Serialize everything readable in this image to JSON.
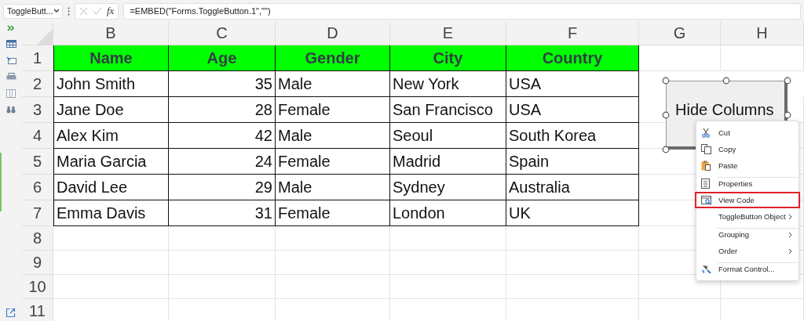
{
  "formula_bar": {
    "name_box": "ToggleButt...",
    "function_label": "fx",
    "formula": "=EMBED(\"Forms.ToggleButton.1\",\"\")"
  },
  "column_headers": [
    "B",
    "C",
    "D",
    "E",
    "F",
    "G",
    "H"
  ],
  "row_headers": [
    "1",
    "2",
    "3",
    "4",
    "5",
    "6",
    "7",
    "8",
    "9",
    "10",
    "11"
  ],
  "table": {
    "columns": [
      "Name",
      "Age",
      "Gender",
      "City",
      "Country"
    ],
    "rows": [
      [
        "John Smith",
        "35",
        "Male",
        "New York",
        "USA"
      ],
      [
        "Jane Doe",
        "28",
        "Female",
        "San Francisco",
        "USA"
      ],
      [
        "Alex Kim",
        "42",
        "Male",
        "Seoul",
        "South Korea"
      ],
      [
        "Maria Garcia",
        "24",
        "Female",
        "Madrid",
        "Spain"
      ],
      [
        "David Lee",
        "29",
        "Male",
        "Sydney",
        "Australia"
      ],
      [
        "Emma Davis",
        "31",
        "Female",
        "London",
        "UK"
      ]
    ]
  },
  "toggle_button": {
    "label": "Hide Columns",
    "selected": true
  },
  "context_menu": [
    {
      "label": "Cut",
      "separator_before": false,
      "highlighted": false,
      "submenu": false
    },
    {
      "label": "Copy",
      "separator_before": false,
      "highlighted": false,
      "submenu": false
    },
    {
      "label": "Paste",
      "separator_before": false,
      "highlighted": false,
      "submenu": false
    },
    {
      "label": "Properties",
      "separator_before": true,
      "highlighted": false,
      "submenu": false
    },
    {
      "label": "View Code",
      "separator_before": false,
      "highlighted": true,
      "submenu": false
    },
    {
      "label": "ToggleButton Object",
      "separator_before": false,
      "highlighted": false,
      "submenu": true
    },
    {
      "label": "Grouping",
      "separator_before": true,
      "highlighted": false,
      "submenu": true
    },
    {
      "label": "Order",
      "separator_before": false,
      "highlighted": false,
      "submenu": true
    },
    {
      "label": "Format Control...",
      "separator_before": true,
      "highlighted": false,
      "submenu": false
    }
  ]
}
